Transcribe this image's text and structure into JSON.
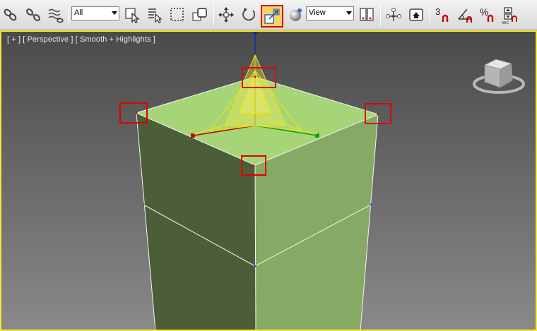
{
  "toolbar": {
    "selection_filter": "All",
    "reference_coord": "View",
    "snap_angle_label": "3",
    "percent_label": "%",
    "spinner_label": "ABC"
  },
  "viewport": {
    "label": "[ + ] [ Perspective ] [ Smooth + Highlights ]"
  },
  "colors": {
    "accent": "#f4ea2e",
    "highlight_box": "#e00000",
    "box_top": "#a6d578",
    "box_left": "#4b5e38",
    "box_right": "#87a966"
  }
}
